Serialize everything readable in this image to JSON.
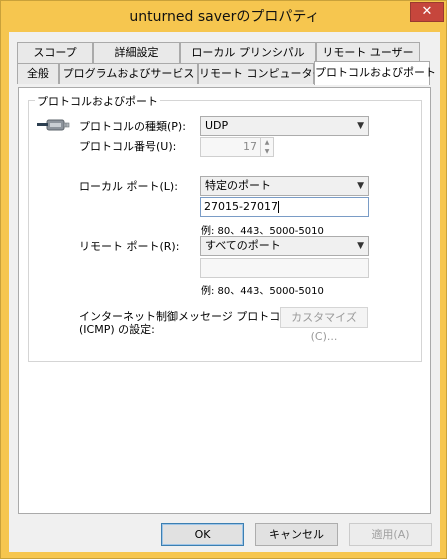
{
  "window": {
    "title": "unturned saverのプロパティ",
    "close_glyph": "✕"
  },
  "tabs": {
    "row1": [
      "スコープ",
      "詳細設定",
      "ローカル プリンシパル",
      "リモート ユーザー"
    ],
    "row2": [
      "全般",
      "プログラムおよびサービス",
      "リモート コンピューター",
      "プロトコルおよびポート"
    ],
    "active": "プロトコルおよびポート"
  },
  "group": {
    "legend": "プロトコルおよびポート",
    "icon": "network-cable-icon"
  },
  "protocol": {
    "type_label": "プロトコルの種類(P):",
    "type_value": "UDP",
    "number_label": "プロトコル番号(U):",
    "number_value": "17"
  },
  "local_port": {
    "label": "ローカル ポート(L):",
    "select_value": "特定のポート",
    "input_value": "27015-27017",
    "example": "例: 80、443、5000-5010"
  },
  "remote_port": {
    "label": "リモート ポート(R):",
    "select_value": "すべてのポート",
    "input_value": "",
    "example": "例: 80、443、5000-5010"
  },
  "icmp": {
    "label_line1": "インターネット制御メッセージ プロトコル",
    "label_line2": "(ICMP) の設定:",
    "button": "カスタマイズ(C)..."
  },
  "footer": {
    "ok": "OK",
    "cancel": "キャンセル",
    "apply": "適用(A)"
  }
}
